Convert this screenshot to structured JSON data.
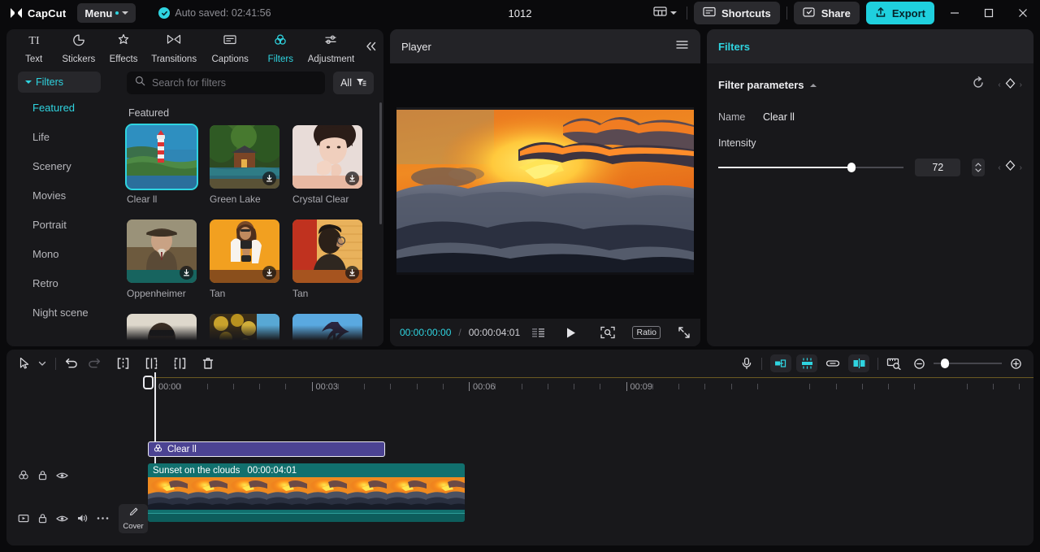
{
  "titlebar": {
    "brand": "CapCut",
    "menu_label": "Menu",
    "autosave": "Auto saved: 02:41:56",
    "project_title": "1012",
    "shortcuts_label": "Shortcuts",
    "share_label": "Share",
    "export_label": "Export",
    "icons": {
      "layout": "layout-icon",
      "shortcuts": "keyboard-icon",
      "share": "share-icon",
      "export": "upload-icon",
      "minimize": "minimize-icon",
      "maximize": "maximize-icon",
      "close": "close-icon"
    }
  },
  "left_panel": {
    "tabs": [
      {
        "label": "Text",
        "icon": "text-icon",
        "active": false
      },
      {
        "label": "Stickers",
        "icon": "sticker-icon",
        "active": false
      },
      {
        "label": "Effects",
        "icon": "sparkle-icon",
        "active": false
      },
      {
        "label": "Transitions",
        "icon": "transition-icon",
        "active": false
      },
      {
        "label": "Captions",
        "icon": "captions-icon",
        "active": false
      },
      {
        "label": "Filters",
        "icon": "filters-icon",
        "active": true
      },
      {
        "label": "Adjustment",
        "icon": "sliders-icon",
        "active": false
      }
    ],
    "collapse_icon": "chevron-double-left-icon",
    "category_header": "Filters",
    "categories": [
      {
        "label": "Featured",
        "active": true
      },
      {
        "label": "Life",
        "active": false
      },
      {
        "label": "Scenery",
        "active": false
      },
      {
        "label": "Movies",
        "active": false
      },
      {
        "label": "Portrait",
        "active": false
      },
      {
        "label": "Mono",
        "active": false
      },
      {
        "label": "Retro",
        "active": false
      },
      {
        "label": "Night scene",
        "active": false
      }
    ],
    "search": {
      "placeholder": "Search for filters",
      "value": "",
      "icon": "search-icon"
    },
    "filter_button": {
      "label": "All",
      "icon": "filter-icon"
    },
    "section_title": "Featured",
    "filters": [
      {
        "label": "Clear ll",
        "selected": true,
        "downloadable": false,
        "art": "lighthouse"
      },
      {
        "label": "Green Lake",
        "selected": false,
        "downloadable": true,
        "art": "lake-cabin"
      },
      {
        "label": "Crystal Clear",
        "selected": false,
        "downloadable": true,
        "art": "portrait-woman"
      },
      {
        "label": "Oppenheimer",
        "selected": false,
        "downloadable": true,
        "art": "man-hat"
      },
      {
        "label": "Tan",
        "selected": false,
        "downloadable": true,
        "art": "woman-orange"
      },
      {
        "label": "Tan",
        "selected": false,
        "downloadable": true,
        "art": "man-red-wall"
      }
    ],
    "filters_row3": [
      {
        "art": "sunglasses"
      },
      {
        "art": "autumn-water"
      },
      {
        "art": "palm-sky"
      }
    ]
  },
  "player": {
    "title": "Player",
    "menu_icon": "hamburger-icon",
    "current_time": "00:00:00:00",
    "separator": "/",
    "total_time": "00:00:04:01",
    "quality_icon": "quality-icon",
    "play_icon": "play-icon",
    "crop_icon": "crop-focus-icon",
    "ratio_label": "Ratio",
    "fullscreen_icon": "fullscreen-icon"
  },
  "right_panel": {
    "title": "Filters",
    "section_title": "Filter parameters",
    "reset_icon": "reset-icon",
    "keyframe_icon": "keyframe-diamond-icon",
    "name_label": "Name",
    "name_value": "Clear ll",
    "intensity_label": "Intensity",
    "intensity_value": "72",
    "intensity_percent": 72
  },
  "timeline": {
    "toolbar": {
      "select_icon": "cursor-select-icon",
      "select_caret": "chevron-down-icon",
      "undo_icon": "undo-icon",
      "redo_icon": "redo-icon",
      "split_icon": "split-icon",
      "trim_left_icon": "trim-left-icon",
      "trim_right_icon": "trim-right-icon",
      "delete_icon": "delete-icon",
      "mic_icon": "microphone-icon",
      "snap_icon": "snap-icon",
      "auto_icon": "auto-cut-icon",
      "link_icon": "link-icon",
      "mirror_icon": "mirror-icon",
      "preview_icon": "preview-ruler-icon",
      "zoom_out_icon": "zoom-out-icon",
      "zoom_in_icon": "zoom-in-icon"
    },
    "ruler_labels": [
      "00:00",
      "00:03",
      "00:06",
      "00:09"
    ],
    "track_filter_header_icons": [
      "filters-icon",
      "lock-icon",
      "eye-icon"
    ],
    "track_video_header_icons": [
      "video-icon",
      "lock-icon",
      "eye-icon",
      "volume-icon",
      "more-icon"
    ],
    "cover_label": "Cover",
    "cover_icon": "pencil-icon",
    "filter_clip": {
      "label": "Clear ll",
      "icon": "filters-icon"
    },
    "video_clip": {
      "name": "Sunset on the clouds",
      "duration": "00:00:04:01"
    }
  }
}
